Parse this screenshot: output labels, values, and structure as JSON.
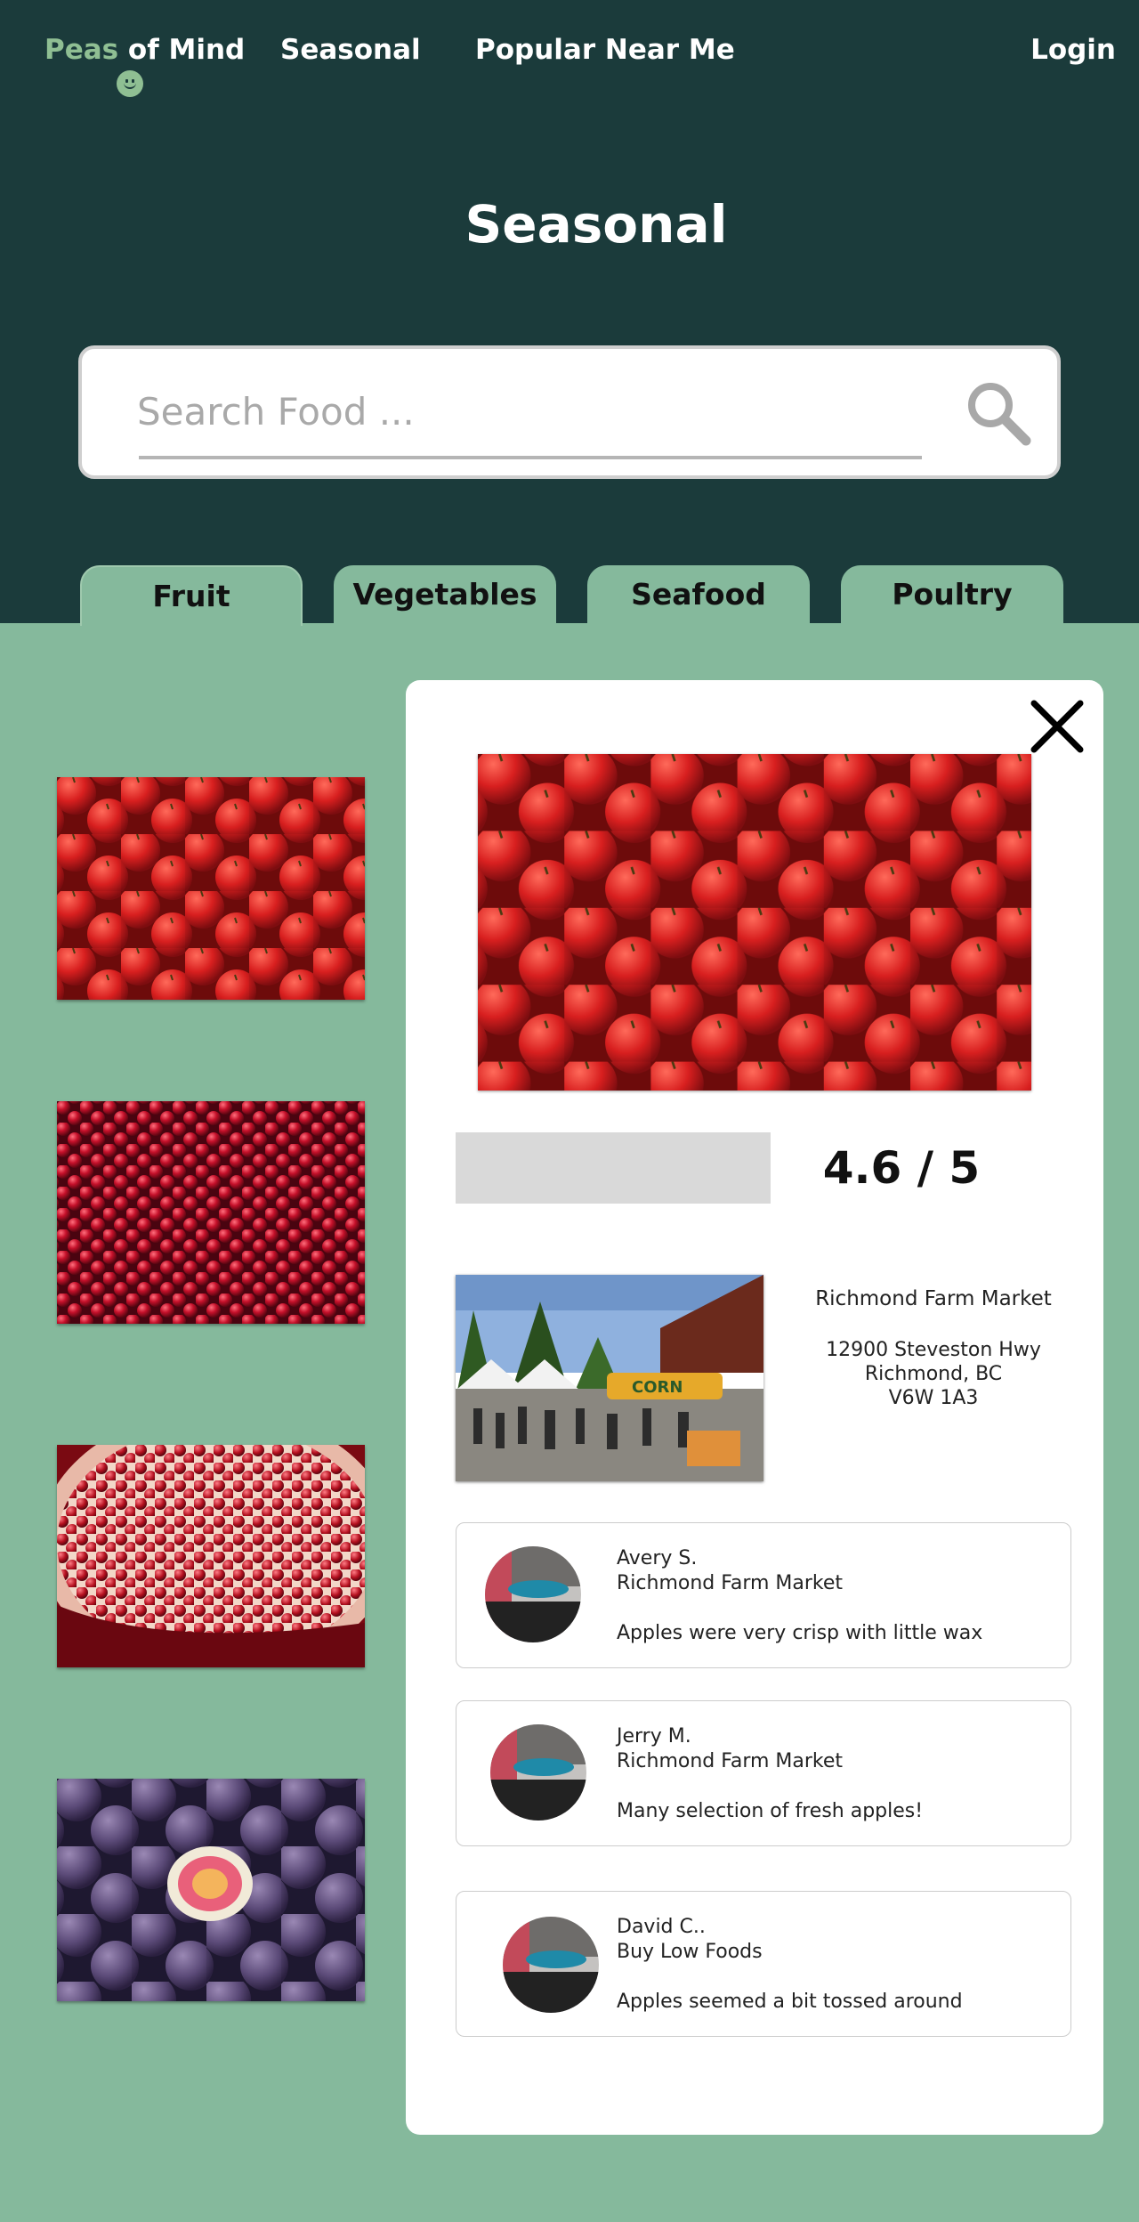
{
  "nav": {
    "logo_part1": "Peas",
    "logo_part2": " of Mind",
    "links": [
      "Seasonal",
      "Popular Near Me"
    ],
    "login": "Login"
  },
  "page_title": "Seasonal",
  "search": {
    "placeholder": "Search Food ..."
  },
  "tabs": [
    {
      "label": "Fruit",
      "active": true
    },
    {
      "label": "Vegetables",
      "active": false
    },
    {
      "label": "Seafood",
      "active": false
    },
    {
      "label": "Poultry",
      "active": false
    }
  ],
  "products": [
    {
      "name": "apples-icon"
    },
    {
      "name": "cranberries-icon"
    },
    {
      "name": "pomegranate-icon"
    },
    {
      "name": "figs-icon"
    }
  ],
  "detail": {
    "rating": "4.6 / 5",
    "market": {
      "name": "Richmond Farm Market",
      "address_line1": "12900 Steveston Hwy",
      "address_line2": "Richmond, BC",
      "address_line3": "V6W 1A3"
    },
    "reviews": [
      {
        "author": "Avery S.",
        "store": "Richmond Farm Market",
        "comment": "Apples were very crisp with little wax"
      },
      {
        "author": "Jerry M.",
        "store": "Richmond Farm Market",
        "comment": "Many selection of fresh apples!"
      },
      {
        "author": "David C..",
        "store": "Buy Low Foods",
        "comment": "Apples seemed a bit tossed around"
      }
    ]
  },
  "colors": {
    "header_bg": "#1b3b3b",
    "body_bg": "#85b99c",
    "logo_accent": "#8fbf93"
  }
}
